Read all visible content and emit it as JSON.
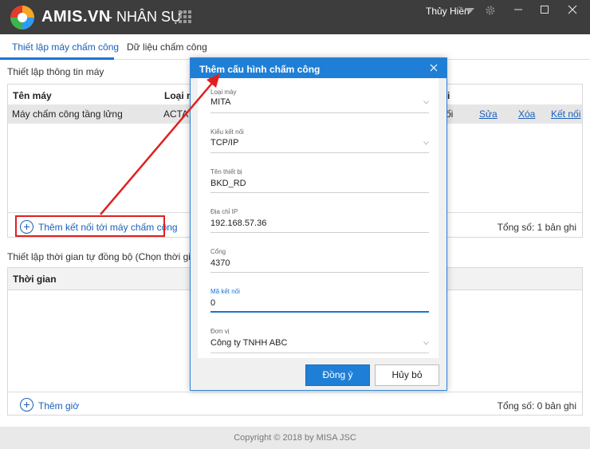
{
  "app": {
    "name": "AMIS.VN",
    "module": "- NHÂN SỰ",
    "user": "Thủy Hiền"
  },
  "tabs": [
    {
      "label": "Thiết lập máy chấm công",
      "active": true
    },
    {
      "label": "Dữ liệu chấm công",
      "active": false
    }
  ],
  "section1": {
    "title": "Thiết lập thông tin máy",
    "columns": [
      "Tên máy",
      "Loại m",
      "i"
    ],
    "row": {
      "name": "Máy chấm công tầng lửng",
      "type": "ACTATE",
      "status": "ối",
      "edit": "Sửa",
      "delete": "Xóa",
      "connect": "Kết nối"
    },
    "add_label": "Thêm kết nối tới máy chấm công",
    "total": "Tổng số: 1 bản ghi"
  },
  "section2": {
    "title": "Thiết lập thời gian tự đồng bộ (Chọn thời gian tự đ",
    "columns": [
      "Thời gian"
    ],
    "add_label": "Thêm giờ",
    "total": "Tổng số: 0 bản ghi"
  },
  "copyright": "Copyright © 2018 by MISA JSC",
  "dialog": {
    "title": "Thêm cấu hình chấm công",
    "fields": {
      "device_type": {
        "label": "Loại máy",
        "value": "MITA"
      },
      "connection_type": {
        "label": "Kiểu kết nối",
        "value": "TCP/IP"
      },
      "device_name": {
        "label": "Tên thiết bị",
        "value": "BKD_RD"
      },
      "ip": {
        "label": "Địa chỉ IP",
        "value": "192.168.57.36"
      },
      "port": {
        "label": "Cổng",
        "value": "4370"
      },
      "connection_code": {
        "label": "Mã kết nối",
        "value": "0"
      },
      "unit": {
        "label": "Đơn vị",
        "value": "Công ty TNHH ABC"
      }
    },
    "ok_label": "Đồng ý",
    "cancel_label": "Hủy bỏ"
  },
  "colors": {
    "accent": "#1f7fd6",
    "titlebar": "#3d3d3d",
    "annotation": "#e02020"
  }
}
